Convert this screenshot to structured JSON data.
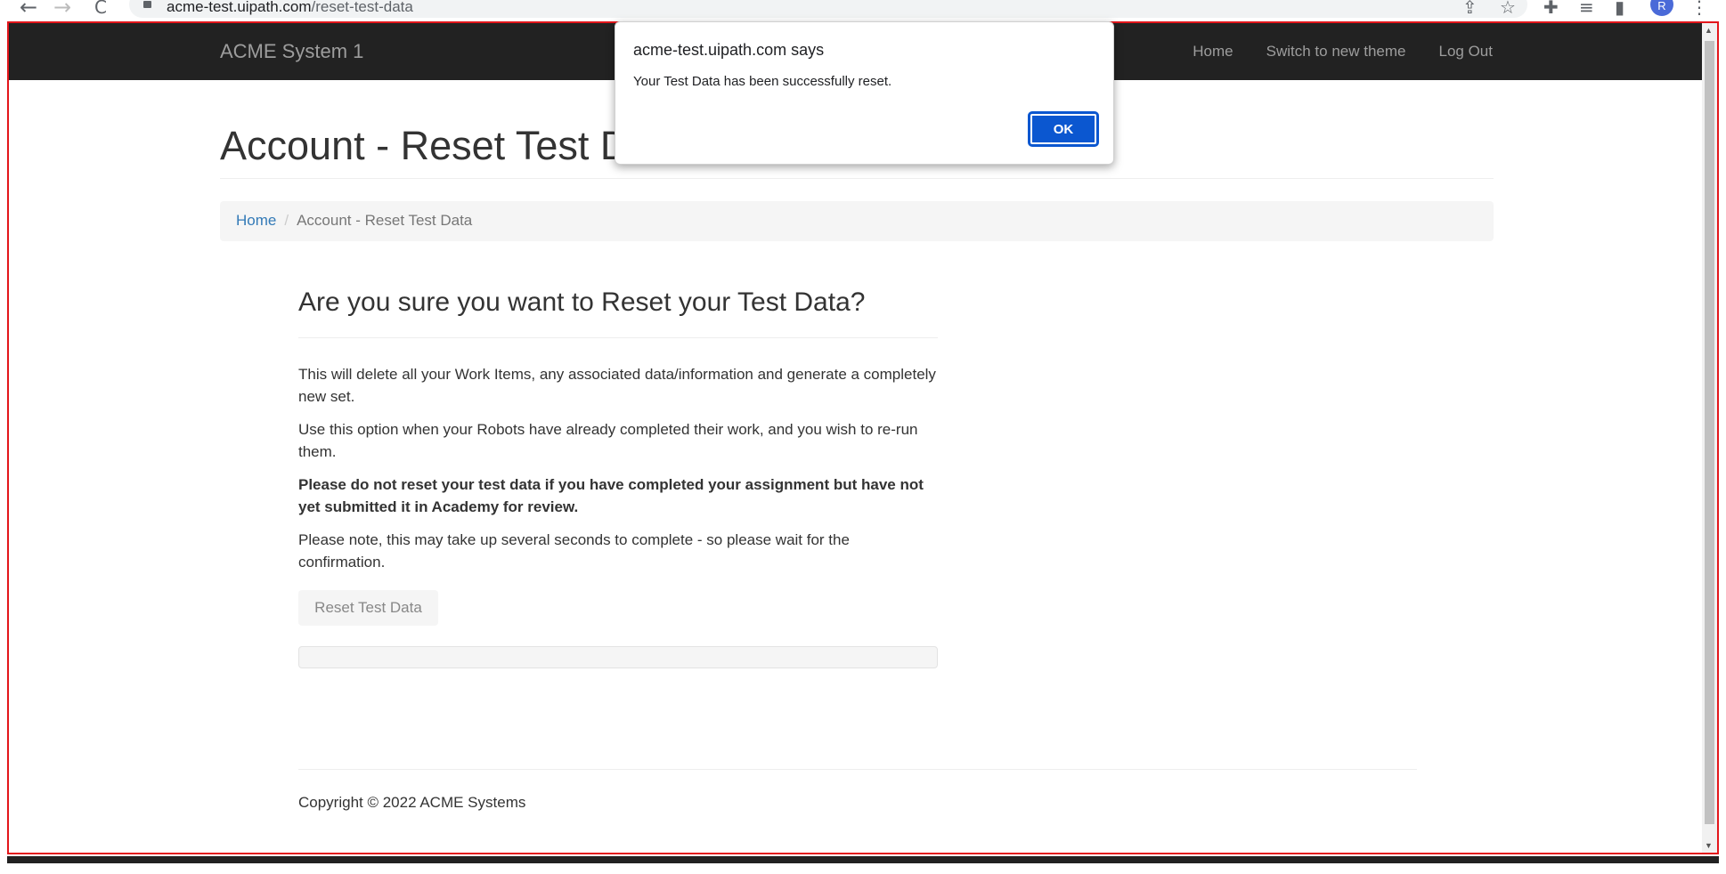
{
  "browser": {
    "back_icon": "←",
    "forward_icon": "→",
    "reload_icon": "C",
    "url_host": "acme-test.uipath.com",
    "url_path": "/reset-test-data",
    "profile_initial": "R"
  },
  "navbar": {
    "brand": "ACME System 1",
    "links": [
      "Home",
      "Switch to new theme",
      "Log Out"
    ]
  },
  "page": {
    "title": "Account - Reset Test D",
    "breadcrumb": {
      "home": "Home",
      "separator": "/",
      "current": "Account - Reset Test Data"
    },
    "question": "Are you sure you want to Reset your Test Data?",
    "paragraphs": {
      "p1": "This will delete all your Work Items, any associated data/information and generate a completely new set.",
      "p2": "Use this option when your Robots have already completed their work, and you wish to re-run them.",
      "p3": "Please do not reset your test data if you have completed your assignment but have not yet submitted it in Academy for review.",
      "p4": "Please note, this may take up several seconds to complete - so please wait for the confirmation."
    },
    "reset_button": "Reset Test Data",
    "footer": "Copyright © 2022 ACME Systems"
  },
  "dialog": {
    "title": "acme-test.uipath.com says",
    "message": "Your Test Data has been successfully reset.",
    "ok_label": "OK"
  },
  "colors": {
    "navbar_bg": "#222222",
    "link": "#337ab7",
    "frame_border": "#e3161b",
    "dialog_button": "#0b57d0"
  }
}
